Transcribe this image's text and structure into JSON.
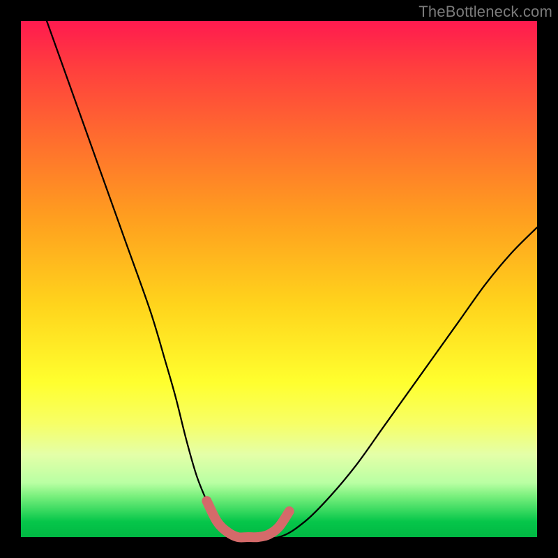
{
  "watermark": "TheBottleneck.com",
  "chart_data": {
    "type": "line",
    "title": "",
    "xlabel": "",
    "ylabel": "",
    "xlim": [
      0,
      100
    ],
    "ylim": [
      0,
      100
    ],
    "grid": false,
    "legend": false,
    "series": [
      {
        "name": "bottleneck-curve",
        "x": [
          5,
          10,
          15,
          20,
          25,
          28,
          30,
          32,
          34,
          36,
          38,
          40,
          42,
          44,
          50,
          55,
          60,
          65,
          70,
          75,
          80,
          85,
          90,
          95,
          100
        ],
        "y": [
          100,
          86,
          72,
          58,
          44,
          34,
          27,
          19,
          12,
          7,
          3,
          1,
          0,
          0,
          0,
          3,
          8,
          14,
          21,
          28,
          35,
          42,
          49,
          55,
          60
        ],
        "color": "#000000",
        "width": 2
      },
      {
        "name": "optimal-range-marker",
        "x": [
          36,
          38,
          40,
          42,
          44,
          46,
          48,
          50,
          52
        ],
        "y": [
          7,
          3,
          1,
          0,
          0,
          0,
          0.5,
          2,
          5
        ],
        "color": "#d46a6a",
        "width": 10
      }
    ],
    "background_gradient_stops": [
      {
        "pct": 0,
        "color": "#ff1a4f"
      },
      {
        "pct": 9,
        "color": "#ff3e3e"
      },
      {
        "pct": 22,
        "color": "#ff6a2f"
      },
      {
        "pct": 38,
        "color": "#ff9e1f"
      },
      {
        "pct": 55,
        "color": "#ffd41c"
      },
      {
        "pct": 70,
        "color": "#ffff2e"
      },
      {
        "pct": 78,
        "color": "#f7ff66"
      },
      {
        "pct": 84,
        "color": "#e4ffa8"
      },
      {
        "pct": 89.5,
        "color": "#b9ffa3"
      },
      {
        "pct": 92,
        "color": "#7bf07e"
      },
      {
        "pct": 95,
        "color": "#34d85e"
      },
      {
        "pct": 97,
        "color": "#06c64a"
      },
      {
        "pct": 100,
        "color": "#00b843"
      }
    ]
  }
}
